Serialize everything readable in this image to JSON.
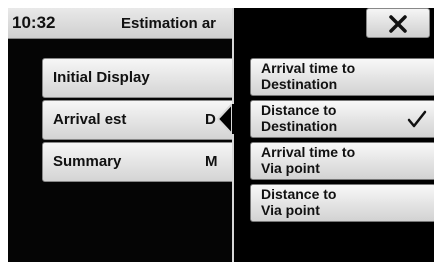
{
  "status": {
    "time": "10:32"
  },
  "screen": {
    "title": "Estimation ar"
  },
  "menu": [
    {
      "label": "Initial Display",
      "value": ""
    },
    {
      "label": "Arrival est",
      "value": "D"
    },
    {
      "label": "Summary",
      "value": "M"
    }
  ],
  "popup": {
    "close_icon": "close-icon",
    "options": [
      {
        "label": "Arrival time to\nDestination",
        "selected": false
      },
      {
        "label": "Distance to\nDestination",
        "selected": true
      },
      {
        "label": "Arrival time to\nVia point",
        "selected": false
      },
      {
        "label": "Distance to\nVia point",
        "selected": false
      }
    ]
  },
  "colors": {
    "background": "#050505",
    "button": "#e4e4e4",
    "text": "#111111"
  }
}
